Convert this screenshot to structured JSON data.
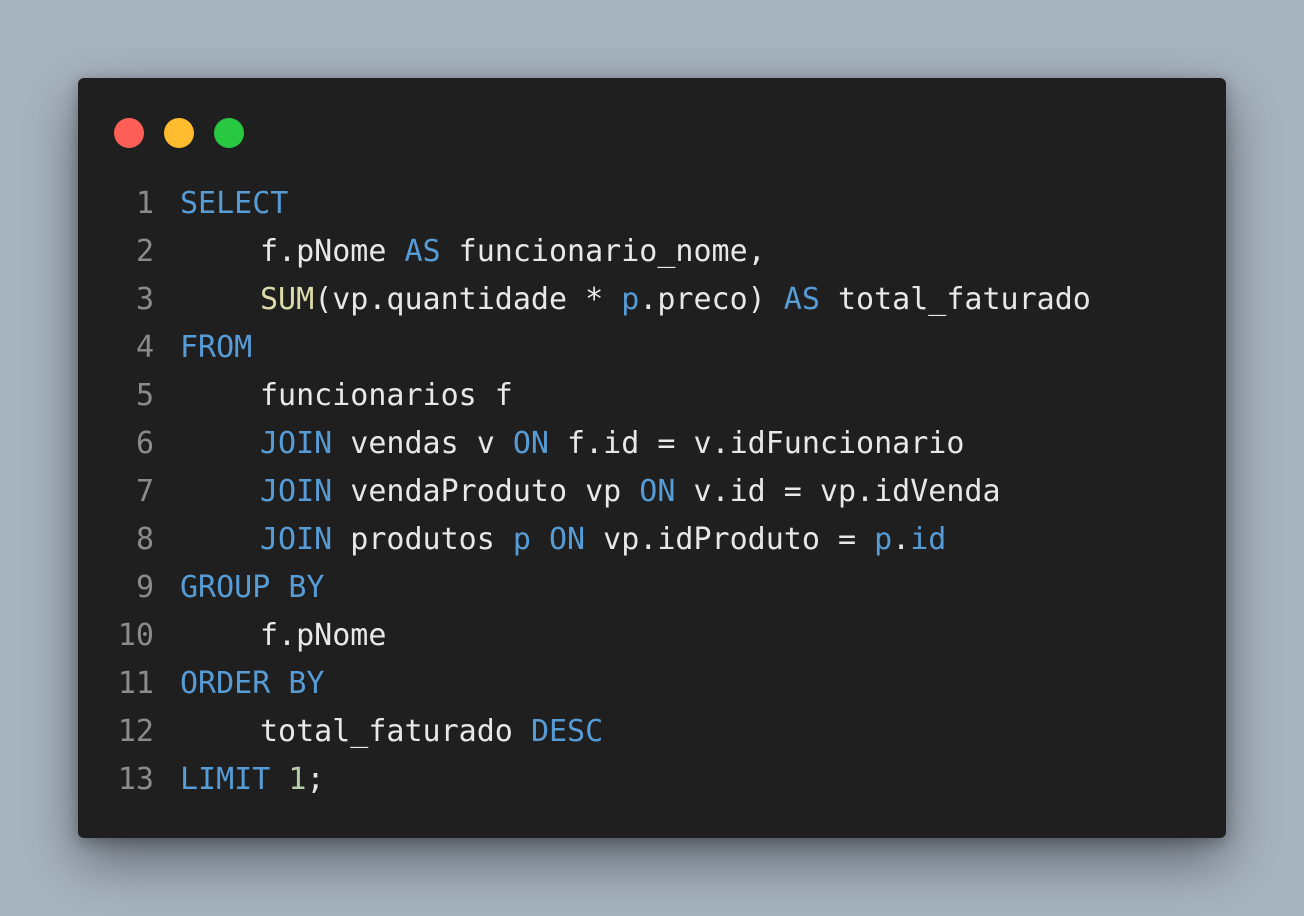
{
  "colors": {
    "background": "#a8b3c0",
    "editor_background": "#1f1f1f",
    "close_dot": "#ff5f57",
    "minimize_dot": "#febc2e",
    "maximize_dot": "#28c840",
    "keyword": "#569cd6",
    "function": "#dcdcaa",
    "number": "#b5cea8",
    "identifier": "#e8e8e8",
    "line_number": "#8b8b8b"
  },
  "code": {
    "lines": [
      {
        "number": "1",
        "indent": false,
        "tokens": [
          {
            "text": "SELECT",
            "kind": "keyword"
          }
        ]
      },
      {
        "number": "2",
        "indent": true,
        "tokens": [
          {
            "text": "f.pNome ",
            "kind": "identifier"
          },
          {
            "text": "AS",
            "kind": "keyword"
          },
          {
            "text": " funcionario_nome,",
            "kind": "identifier"
          }
        ]
      },
      {
        "number": "3",
        "indent": true,
        "tokens": [
          {
            "text": "SUM",
            "kind": "function"
          },
          {
            "text": "(vp.quantidade * ",
            "kind": "identifier"
          },
          {
            "text": "p",
            "kind": "keyword"
          },
          {
            "text": ".preco) ",
            "kind": "identifier"
          },
          {
            "text": "AS",
            "kind": "keyword"
          },
          {
            "text": " total_faturado",
            "kind": "identifier"
          }
        ]
      },
      {
        "number": "4",
        "indent": false,
        "tokens": [
          {
            "text": "FROM",
            "kind": "keyword"
          }
        ]
      },
      {
        "number": "5",
        "indent": true,
        "tokens": [
          {
            "text": "funcionarios f",
            "kind": "identifier"
          }
        ]
      },
      {
        "number": "6",
        "indent": true,
        "tokens": [
          {
            "text": "JOIN",
            "kind": "keyword"
          },
          {
            "text": " vendas v ",
            "kind": "identifier"
          },
          {
            "text": "ON",
            "kind": "keyword"
          },
          {
            "text": " f.id = v.idFuncionario",
            "kind": "identifier"
          }
        ]
      },
      {
        "number": "7",
        "indent": true,
        "tokens": [
          {
            "text": "JOIN",
            "kind": "keyword"
          },
          {
            "text": " vendaProduto vp ",
            "kind": "identifier"
          },
          {
            "text": "ON",
            "kind": "keyword"
          },
          {
            "text": " v.id = vp.idVenda",
            "kind": "identifier"
          }
        ]
      },
      {
        "number": "8",
        "indent": true,
        "tokens": [
          {
            "text": "JOIN",
            "kind": "keyword"
          },
          {
            "text": " produtos ",
            "kind": "identifier"
          },
          {
            "text": "p",
            "kind": "keyword"
          },
          {
            "text": " ",
            "kind": "identifier"
          },
          {
            "text": "ON",
            "kind": "keyword"
          },
          {
            "text": " vp.idProduto = ",
            "kind": "identifier"
          },
          {
            "text": "p",
            "kind": "keyword"
          },
          {
            "text": ".",
            "kind": "identifier"
          },
          {
            "text": "id",
            "kind": "keyword"
          }
        ]
      },
      {
        "number": "9",
        "indent": false,
        "tokens": [
          {
            "text": "GROUP BY",
            "kind": "keyword"
          }
        ]
      },
      {
        "number": "10",
        "indent": true,
        "tokens": [
          {
            "text": "f.pNome",
            "kind": "identifier"
          }
        ]
      },
      {
        "number": "11",
        "indent": false,
        "tokens": [
          {
            "text": "ORDER BY",
            "kind": "keyword"
          }
        ]
      },
      {
        "number": "12",
        "indent": true,
        "tokens": [
          {
            "text": "total_faturado ",
            "kind": "identifier"
          },
          {
            "text": "DESC",
            "kind": "keyword"
          }
        ]
      },
      {
        "number": "13",
        "indent": false,
        "tokens": [
          {
            "text": "LIMIT",
            "kind": "keyword"
          },
          {
            "text": " ",
            "kind": "identifier"
          },
          {
            "text": "1",
            "kind": "number"
          },
          {
            "text": ";",
            "kind": "identifier"
          }
        ]
      }
    ]
  }
}
